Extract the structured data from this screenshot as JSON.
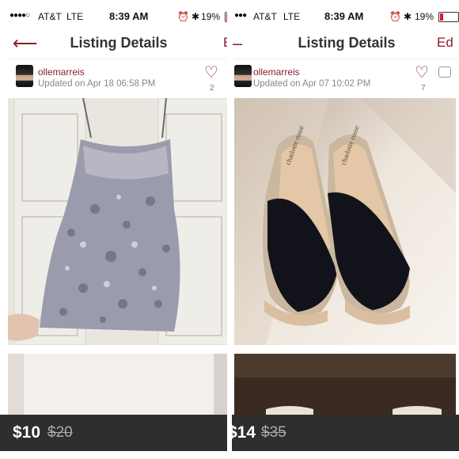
{
  "left": {
    "status": {
      "signal": "●●●●○",
      "carrier": "AT&T",
      "network": "LTE",
      "time": "8:39 AM",
      "battery": "19%"
    },
    "nav": {
      "title": "Listing Details"
    },
    "seller": {
      "username": "ollemarreis",
      "updated": "Updated on Apr 18 06:58 PM",
      "likes": "2"
    },
    "price": "$10",
    "original_price": "$20"
  },
  "right": {
    "status": {
      "signal": "●●●",
      "carrier": "AT&T",
      "network": "LTE",
      "time": "8:39 AM",
      "battery": "19%"
    },
    "nav": {
      "title": "Listing Details",
      "edit_label": "Ed"
    },
    "seller": {
      "username": "ollemarreis",
      "updated": "Updated on Apr 07 10:02 PM",
      "likes": "7"
    },
    "price": "$14",
    "original_price": "$35"
  },
  "colors": {
    "brand": "#8c1c2c",
    "price_bar": "#2e2e2e",
    "battery_low": "#e0132f"
  },
  "icons": {
    "back": "arrow-left-icon",
    "like": "heart-outline-icon",
    "comment": "comment-icon",
    "alarm": "alarm-icon",
    "bluetooth": "bluetooth-icon"
  }
}
